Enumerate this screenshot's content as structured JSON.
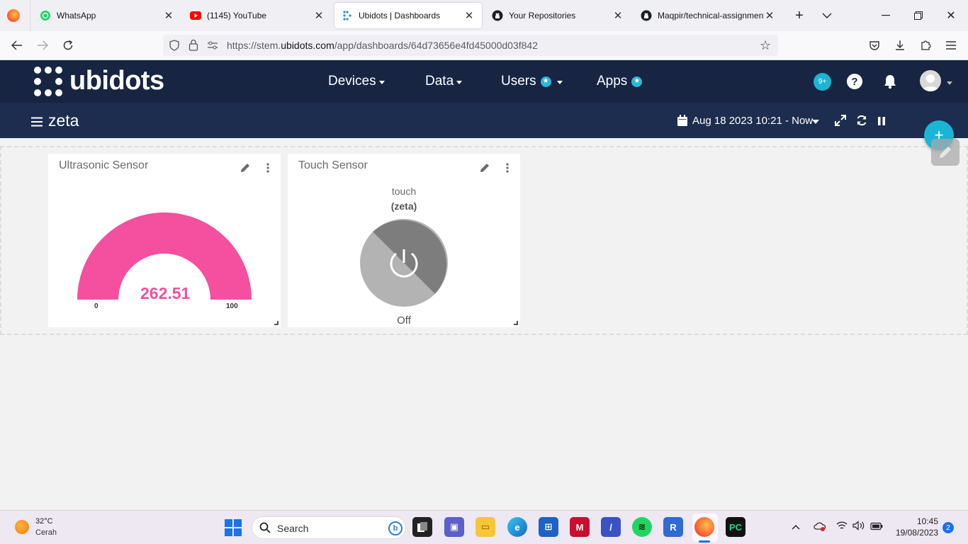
{
  "browser": {
    "tabs": [
      {
        "label": "WhatsApp",
        "icon": "whatsapp-icon"
      },
      {
        "label": "(1145) YouTube",
        "icon": "youtube-icon"
      },
      {
        "label": "Ubidots | Dashboards",
        "icon": "ubidots-icon"
      },
      {
        "label": "Your Repositories",
        "icon": "github-icon"
      },
      {
        "label": "Maqpir/technical-assignment",
        "icon": "github-icon"
      }
    ],
    "url_prefix": "https://stem.",
    "url_domain": "ubidots.com",
    "url_path": "/app/dashboards/64d73656e4fd45000d03f842"
  },
  "header": {
    "logo": "ubidots",
    "menu": {
      "devices": "Devices",
      "data": "Data",
      "users": "Users",
      "apps": "Apps"
    },
    "notifications_badge": "9+"
  },
  "dashboard": {
    "name": "zeta",
    "date_range": "Aug 18 2023 10:21 - Now"
  },
  "widgets": {
    "ultrasonic": {
      "title": "Ultrasonic Sensor",
      "value": "262.51",
      "min": "0",
      "max": "100",
      "color": "#f54f9f"
    },
    "touch": {
      "title": "Touch Sensor",
      "variable": "touch",
      "device": "(zeta)",
      "state": "Off"
    }
  },
  "taskbar": {
    "weather_temp": "32°C",
    "weather_desc": "Cerah",
    "search_placeholder": "Search",
    "time": "10:45",
    "date": "19/08/2023",
    "notification_count": "2"
  }
}
